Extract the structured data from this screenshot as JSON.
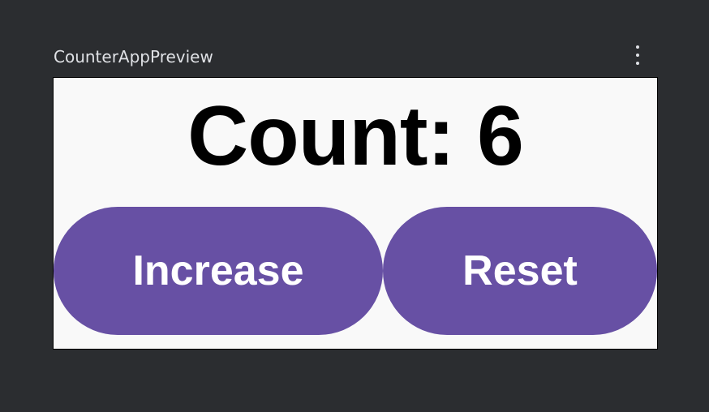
{
  "preview": {
    "title": "CounterAppPreview",
    "menu_icon": "vertical-ellipsis-icon"
  },
  "app": {
    "count_text": "Count: 6",
    "increase_label": "Increase",
    "reset_label": "Reset",
    "button_color": "#6750a4",
    "background_color": "#f9f9f9"
  }
}
